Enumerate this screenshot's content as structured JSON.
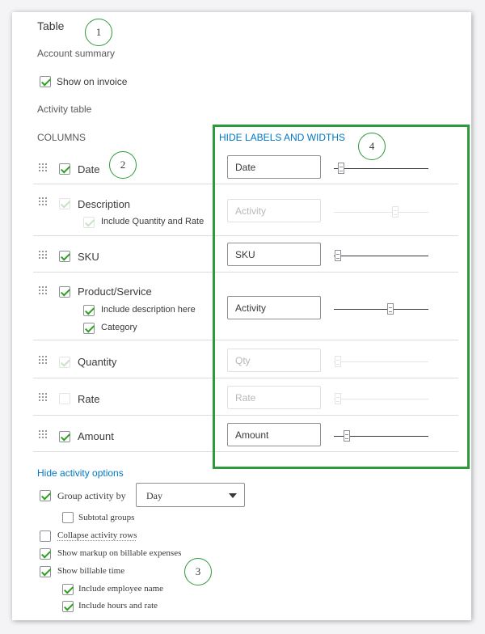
{
  "panel": {
    "title": "Table",
    "account_summary": "Account summary",
    "show_on_invoice": {
      "label": "Show on invoice",
      "checked": true
    },
    "activity_table": "Activity table",
    "columns_header": "COLUMNS",
    "hide_labels_link": "HIDE LABELS AND WIDTHS"
  },
  "columns": [
    {
      "label": "Date",
      "checked": true,
      "disabled": false,
      "input_value": "Date",
      "input_disabled": false,
      "slider_level": 0.08
    },
    {
      "label": "Description",
      "checked": true,
      "disabled": true,
      "sub": [
        {
          "label": "Include Quantity and Rate",
          "checked": true,
          "disabled": true
        }
      ],
      "input_placeholder": "Activity",
      "input_disabled": true,
      "slider_level": 0.65
    },
    {
      "label": "SKU",
      "checked": true,
      "disabled": false,
      "input_value": "SKU",
      "input_disabled": false,
      "slider_level": 0.04
    },
    {
      "label": "Product/Service",
      "checked": true,
      "disabled": false,
      "sub": [
        {
          "label": "Include description here",
          "checked": true
        },
        {
          "label": "Category",
          "checked": true
        }
      ],
      "input_value": "Activity",
      "input_disabled": false,
      "slider_level": 0.6
    },
    {
      "label": "Quantity",
      "checked": true,
      "disabled": true,
      "input_placeholder": "Qty",
      "input_disabled": true,
      "slider_level": 0.04
    },
    {
      "label": "Rate",
      "checked": false,
      "disabled": false,
      "input_placeholder": "Rate",
      "input_disabled": true,
      "slider_level": 0.04
    },
    {
      "label": "Amount",
      "checked": true,
      "disabled": false,
      "input_value": "Amount",
      "input_disabled": false,
      "slider_level": 0.14
    }
  ],
  "activity_options": {
    "link": "Hide activity options",
    "group_activity_by": {
      "label": "Group activity by",
      "checked": true,
      "select_value": "Day"
    },
    "subtotal_groups": {
      "label": "Subtotal groups",
      "checked": false
    },
    "collapse_activity_rows": {
      "label": "Collapse activity rows",
      "checked": false
    },
    "show_markup": {
      "label": "Show markup on billable expenses",
      "checked": true
    },
    "show_billable_time": {
      "label": "Show billable time",
      "checked": true
    },
    "include_employee_name": {
      "label": "Include employee name",
      "checked": true
    },
    "include_hours_and_rate": {
      "label": "Include hours and rate",
      "checked": true
    }
  },
  "callouts": [
    "1",
    "2",
    "3",
    "4"
  ],
  "colors": {
    "accent_green": "#2ca01c",
    "annotation_green": "#2e9a3a",
    "link_blue": "#0077c5",
    "text": "#393a3d"
  }
}
